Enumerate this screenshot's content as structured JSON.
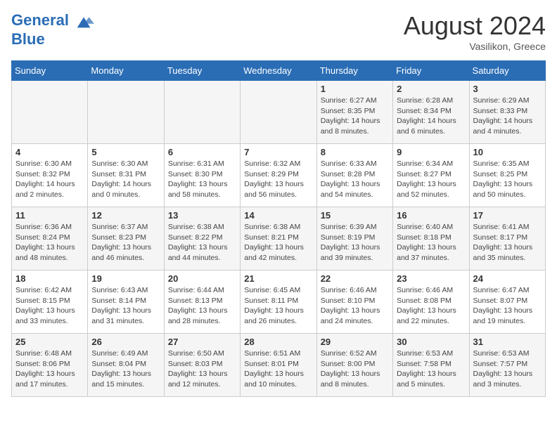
{
  "header": {
    "logo_line1": "General",
    "logo_line2": "Blue",
    "month_year": "August 2024",
    "location": "Vasilikon, Greece"
  },
  "weekdays": [
    "Sunday",
    "Monday",
    "Tuesday",
    "Wednesday",
    "Thursday",
    "Friday",
    "Saturday"
  ],
  "weeks": [
    [
      {
        "day": "",
        "info": ""
      },
      {
        "day": "",
        "info": ""
      },
      {
        "day": "",
        "info": ""
      },
      {
        "day": "",
        "info": ""
      },
      {
        "day": "1",
        "info": "Sunrise: 6:27 AM\nSunset: 8:35 PM\nDaylight: 14 hours and 8 minutes."
      },
      {
        "day": "2",
        "info": "Sunrise: 6:28 AM\nSunset: 8:34 PM\nDaylight: 14 hours and 6 minutes."
      },
      {
        "day": "3",
        "info": "Sunrise: 6:29 AM\nSunset: 8:33 PM\nDaylight: 14 hours and 4 minutes."
      }
    ],
    [
      {
        "day": "4",
        "info": "Sunrise: 6:30 AM\nSunset: 8:32 PM\nDaylight: 14 hours and 2 minutes."
      },
      {
        "day": "5",
        "info": "Sunrise: 6:30 AM\nSunset: 8:31 PM\nDaylight: 14 hours and 0 minutes."
      },
      {
        "day": "6",
        "info": "Sunrise: 6:31 AM\nSunset: 8:30 PM\nDaylight: 13 hours and 58 minutes."
      },
      {
        "day": "7",
        "info": "Sunrise: 6:32 AM\nSunset: 8:29 PM\nDaylight: 13 hours and 56 minutes."
      },
      {
        "day": "8",
        "info": "Sunrise: 6:33 AM\nSunset: 8:28 PM\nDaylight: 13 hours and 54 minutes."
      },
      {
        "day": "9",
        "info": "Sunrise: 6:34 AM\nSunset: 8:27 PM\nDaylight: 13 hours and 52 minutes."
      },
      {
        "day": "10",
        "info": "Sunrise: 6:35 AM\nSunset: 8:25 PM\nDaylight: 13 hours and 50 minutes."
      }
    ],
    [
      {
        "day": "11",
        "info": "Sunrise: 6:36 AM\nSunset: 8:24 PM\nDaylight: 13 hours and 48 minutes."
      },
      {
        "day": "12",
        "info": "Sunrise: 6:37 AM\nSunset: 8:23 PM\nDaylight: 13 hours and 46 minutes."
      },
      {
        "day": "13",
        "info": "Sunrise: 6:38 AM\nSunset: 8:22 PM\nDaylight: 13 hours and 44 minutes."
      },
      {
        "day": "14",
        "info": "Sunrise: 6:38 AM\nSunset: 8:21 PM\nDaylight: 13 hours and 42 minutes."
      },
      {
        "day": "15",
        "info": "Sunrise: 6:39 AM\nSunset: 8:19 PM\nDaylight: 13 hours and 39 minutes."
      },
      {
        "day": "16",
        "info": "Sunrise: 6:40 AM\nSunset: 8:18 PM\nDaylight: 13 hours and 37 minutes."
      },
      {
        "day": "17",
        "info": "Sunrise: 6:41 AM\nSunset: 8:17 PM\nDaylight: 13 hours and 35 minutes."
      }
    ],
    [
      {
        "day": "18",
        "info": "Sunrise: 6:42 AM\nSunset: 8:15 PM\nDaylight: 13 hours and 33 minutes."
      },
      {
        "day": "19",
        "info": "Sunrise: 6:43 AM\nSunset: 8:14 PM\nDaylight: 13 hours and 31 minutes."
      },
      {
        "day": "20",
        "info": "Sunrise: 6:44 AM\nSunset: 8:13 PM\nDaylight: 13 hours and 28 minutes."
      },
      {
        "day": "21",
        "info": "Sunrise: 6:45 AM\nSunset: 8:11 PM\nDaylight: 13 hours and 26 minutes."
      },
      {
        "day": "22",
        "info": "Sunrise: 6:46 AM\nSunset: 8:10 PM\nDaylight: 13 hours and 24 minutes."
      },
      {
        "day": "23",
        "info": "Sunrise: 6:46 AM\nSunset: 8:08 PM\nDaylight: 13 hours and 22 minutes."
      },
      {
        "day": "24",
        "info": "Sunrise: 6:47 AM\nSunset: 8:07 PM\nDaylight: 13 hours and 19 minutes."
      }
    ],
    [
      {
        "day": "25",
        "info": "Sunrise: 6:48 AM\nSunset: 8:06 PM\nDaylight: 13 hours and 17 minutes."
      },
      {
        "day": "26",
        "info": "Sunrise: 6:49 AM\nSunset: 8:04 PM\nDaylight: 13 hours and 15 minutes."
      },
      {
        "day": "27",
        "info": "Sunrise: 6:50 AM\nSunset: 8:03 PM\nDaylight: 13 hours and 12 minutes."
      },
      {
        "day": "28",
        "info": "Sunrise: 6:51 AM\nSunset: 8:01 PM\nDaylight: 13 hours and 10 minutes."
      },
      {
        "day": "29",
        "info": "Sunrise: 6:52 AM\nSunset: 8:00 PM\nDaylight: 13 hours and 8 minutes."
      },
      {
        "day": "30",
        "info": "Sunrise: 6:53 AM\nSunset: 7:58 PM\nDaylight: 13 hours and 5 minutes."
      },
      {
        "day": "31",
        "info": "Sunrise: 6:53 AM\nSunset: 7:57 PM\nDaylight: 13 hours and 3 minutes."
      }
    ]
  ]
}
